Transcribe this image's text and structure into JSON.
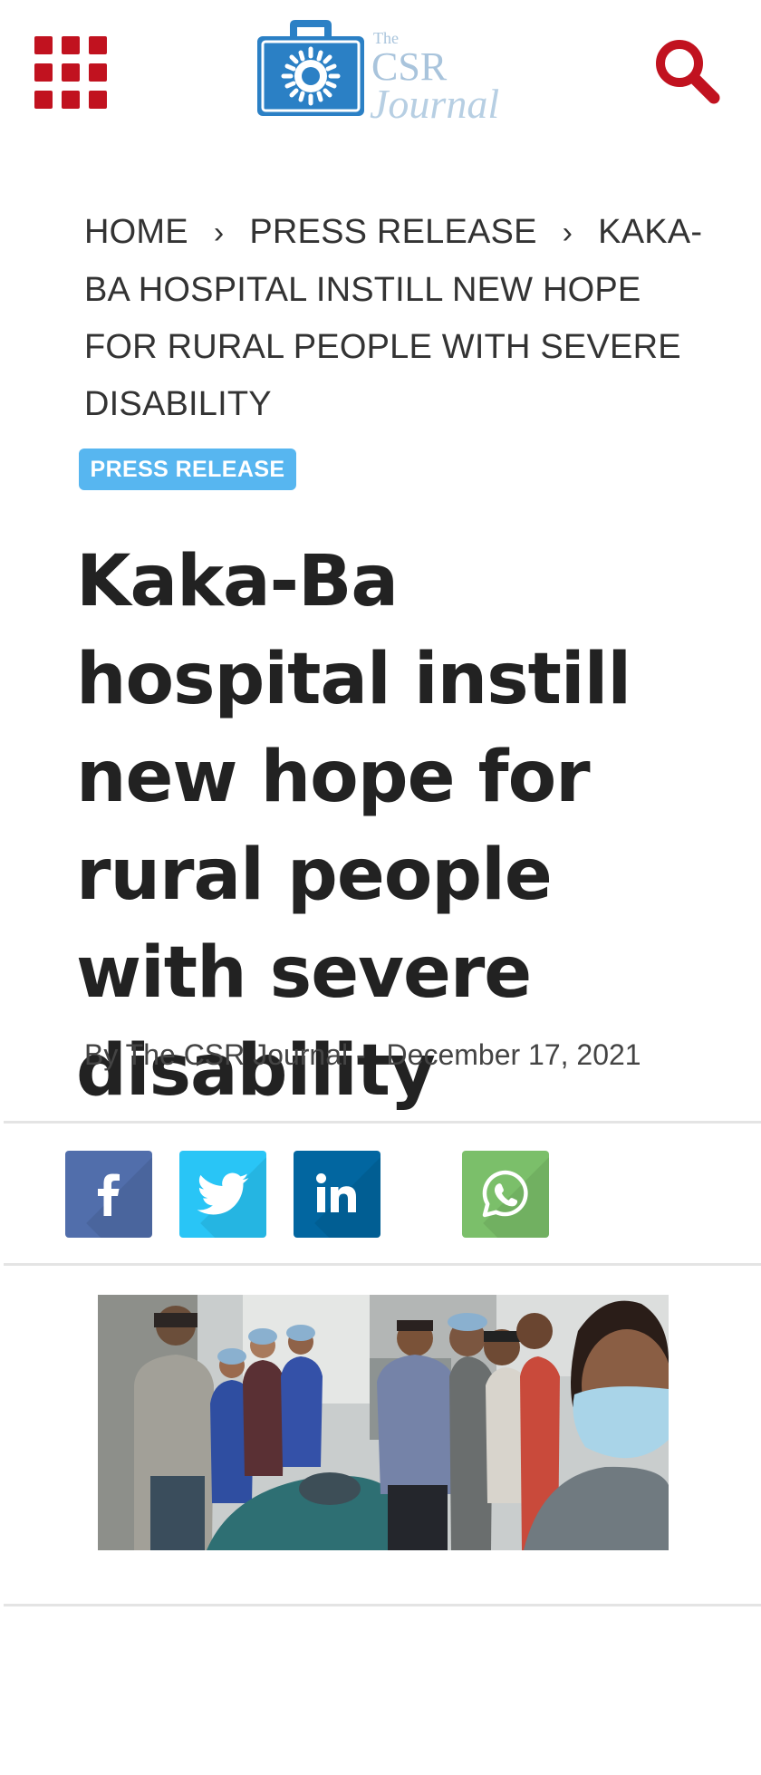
{
  "header": {
    "menu_icon": "grid-menu-icon",
    "logo_text": "The CSR Journal",
    "search_icon": "search-icon",
    "accent_color": "#c1121f"
  },
  "breadcrumb": {
    "home": "HOME",
    "section": "PRESS RELEASE",
    "current": "KAKA-BA HOSPITAL INSTILL NEW HOPE FOR RURAL PEOPLE WITH SEVERE DISABILITY"
  },
  "article": {
    "category": "PRESS RELEASE",
    "category_color": "#57b6f0",
    "title": "Kaka-Ba hospital instill new hope for rural people with severe disability",
    "author_prefix": "By",
    "author": "The CSR Journal",
    "separator": "-",
    "date": "December 17, 2021"
  },
  "share": [
    {
      "network": "facebook",
      "icon": "facebook-icon",
      "color": "#516eab"
    },
    {
      "network": "twitter",
      "icon": "twitter-icon",
      "color": "#29c5f6"
    },
    {
      "network": "linkedin",
      "icon": "linkedin-icon",
      "color": "#0266a0"
    },
    {
      "network": "whatsapp",
      "icon": "whatsapp-icon",
      "color": "#7bbf6a"
    }
  ],
  "featured_image": {
    "alt": "Hospital staff and doctors posing for a selfie in an operating theatre"
  }
}
